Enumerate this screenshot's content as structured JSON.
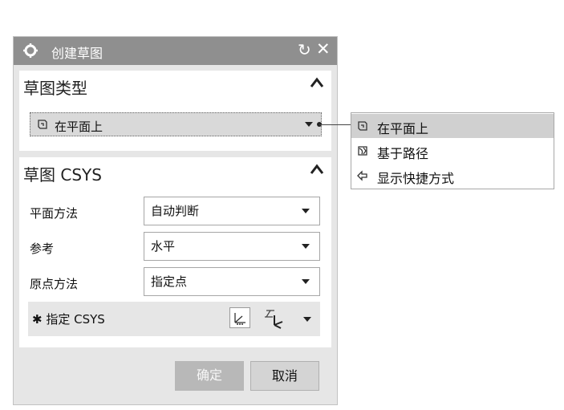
{
  "dialog": {
    "title": "创建草图",
    "icons": {
      "settings": "gear-icon",
      "reset": "reset-icon",
      "close": "close-icon"
    }
  },
  "sketch_type": {
    "title": "草图类型",
    "selected": "在平面上"
  },
  "sketch_csys": {
    "title": "草图 CSYS",
    "rows": [
      {
        "label": "平面方法",
        "value": "自动判断"
      },
      {
        "label": "参考",
        "value": "水平"
      },
      {
        "label": "原点方法",
        "value": "指定点"
      }
    ],
    "specify_csys_label": "✱ 指定 CSYS"
  },
  "buttons": {
    "ok": "确定",
    "cancel": "取消"
  },
  "dropdown": {
    "items": [
      {
        "label": "在平面上",
        "icon": "plane-sketch-icon",
        "selected": true
      },
      {
        "label": "基于路径",
        "icon": "path-sketch-icon",
        "selected": false
      },
      {
        "label": "显示快捷方式",
        "icon": "shortcut-icon",
        "selected": false
      }
    ]
  },
  "colors": {
    "titlebar": "#8f8f8f",
    "dialog_bg": "#e6e6e6",
    "selected_bg": "#d0d0d0"
  }
}
